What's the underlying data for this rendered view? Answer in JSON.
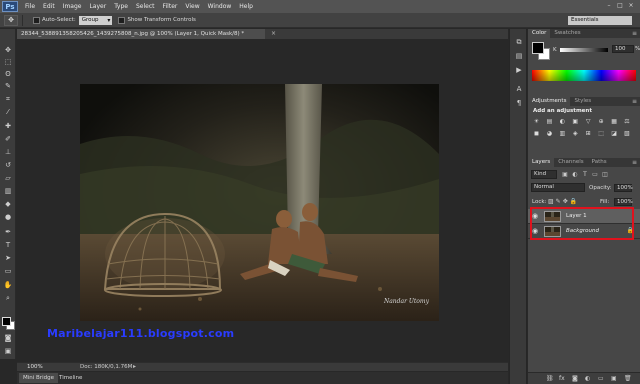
{
  "app": {
    "logo": "Ps",
    "menu": [
      "File",
      "Edit",
      "Image",
      "Layer",
      "Type",
      "Select",
      "Filter",
      "View",
      "Window",
      "Help"
    ],
    "window_controls": [
      "–",
      "□",
      "×"
    ]
  },
  "options_bar": {
    "tool_icon": "move-tool-icon",
    "auto_select_label": "Auto-Select:",
    "auto_select_value": "Group",
    "transform_label": "Show Transform Controls",
    "workspace": "Essentials"
  },
  "document": {
    "tab_title": "28344_538891358205426_1439275808_n.jpg @ 100% (Layer 1, Quick Mask/8) *",
    "close_glyph": "×",
    "signature": "Nandar Utomy",
    "zoom": "100%",
    "doc_size": "Doc: 180K/0,1.76M"
  },
  "watermark": "Maribelajar111.blogspot.com",
  "bottom_tabs": [
    "Mini Bridge",
    "Timeline"
  ],
  "color_panel": {
    "tabs": [
      "Color",
      "Swatches"
    ],
    "channel_label": "K",
    "channel_value": "100",
    "percent": "%",
    "fg_color": "#000000",
    "bg_color": "#ffffff"
  },
  "adjustments_panel": {
    "tabs": [
      "Adjustments",
      "Styles"
    ],
    "title": "Add an adjustment",
    "icons": [
      "☀",
      "▤",
      "◐",
      "▣",
      "▽",
      "⊕",
      "▦",
      "⚖",
      "◼",
      "◕",
      "▥",
      "◈",
      "⊞",
      "⬚",
      "◪",
      "▧"
    ]
  },
  "layers_panel": {
    "tabs": [
      "Layers",
      "Channels",
      "Paths"
    ],
    "kind": "Kind",
    "blend_mode": "Normal",
    "opacity_label": "Opacity:",
    "opacity_value": "100%",
    "lock_label": "Lock:",
    "fill_label": "Fill:",
    "fill_value": "100%",
    "layers": [
      {
        "name": "Layer 1",
        "selected": true
      },
      {
        "name": "Background",
        "selected": false
      }
    ],
    "highlight_color": "#e0121d"
  }
}
